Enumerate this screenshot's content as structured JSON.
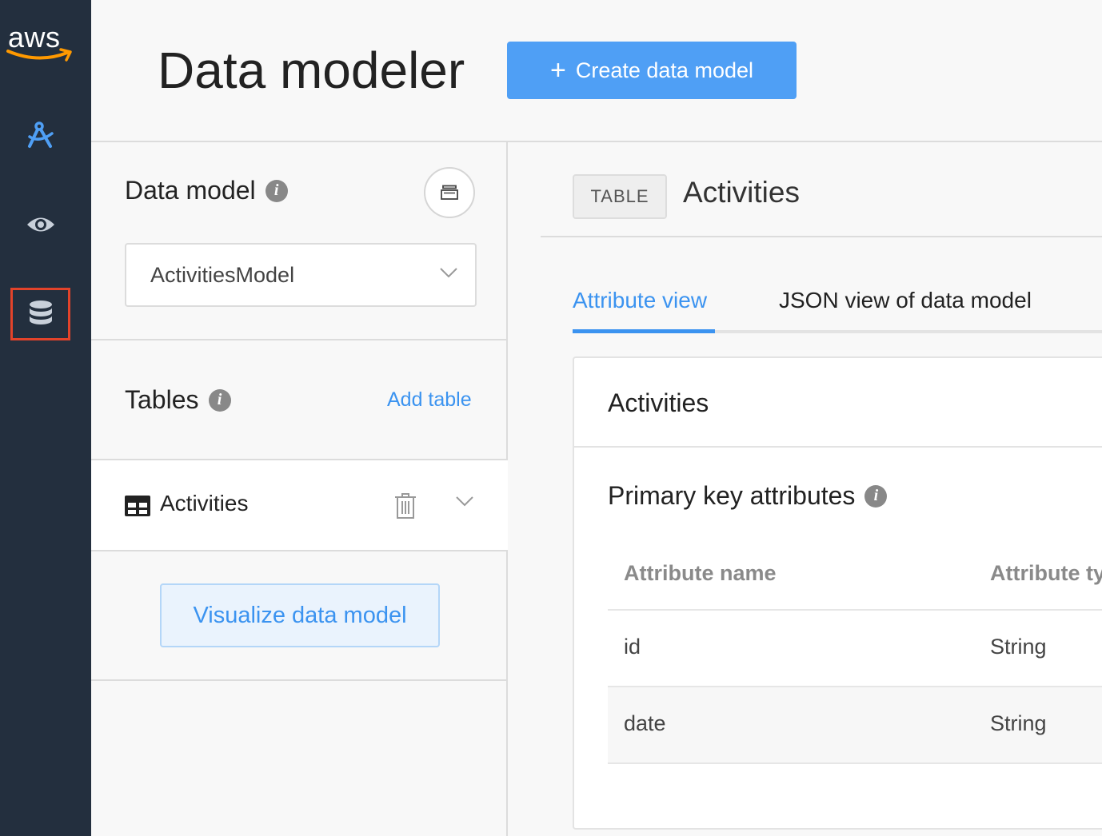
{
  "brand": {
    "logo_text": "aws",
    "smile_color": "#ff9900"
  },
  "nav": {
    "items": [
      {
        "icon": "build-icon",
        "color": "#4f9ff5"
      },
      {
        "icon": "eye-icon",
        "color": "#c8d0da"
      },
      {
        "icon": "database-icon",
        "color": "#c8d0da",
        "active": true
      }
    ]
  },
  "header": {
    "title": "Data modeler",
    "create_button": {
      "icon": "plus-icon",
      "label": "Create data model"
    }
  },
  "left_panel": {
    "data_model": {
      "title": "Data model",
      "selected": "ActivitiesModel",
      "action_icon": "archive-icon"
    },
    "tables": {
      "title": "Tables",
      "add_label": "Add table",
      "items": [
        {
          "label": "Activities",
          "icon": "table-icon"
        }
      ]
    },
    "visualize_label": "Visualize data model"
  },
  "detail": {
    "badge": "TABLE",
    "title": "Activities",
    "tabs": [
      {
        "label": "Attribute view",
        "active": true
      },
      {
        "label": "JSON view of data model",
        "active": false
      }
    ],
    "card": {
      "title": "Activities",
      "primary_key": {
        "title": "Primary key attributes",
        "columns": [
          "Attribute name",
          "Attribute type"
        ],
        "rows": [
          {
            "name": "id",
            "type": "String"
          },
          {
            "name": "date",
            "type": "String"
          }
        ]
      }
    }
  },
  "colors": {
    "accent": "#3b93f0",
    "button": "#4f9ff5",
    "sidebar": "#232f3e",
    "highlight": "#e2432a"
  }
}
